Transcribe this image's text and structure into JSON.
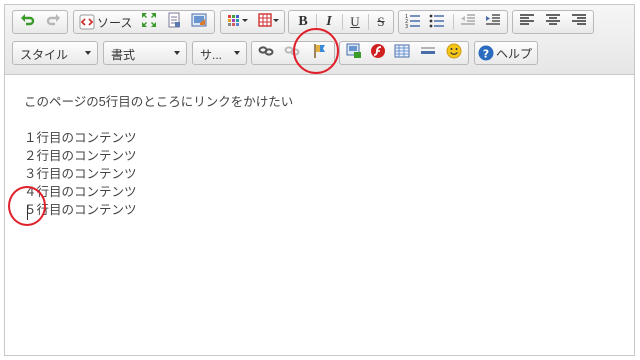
{
  "toolbar": {
    "source_label": "ソース",
    "bold_label": "B",
    "italic_label": "I",
    "underline_label": "U",
    "strike_label": "S",
    "help_label": "ヘルプ",
    "combos": {
      "style": "スタイル",
      "format": "書式",
      "size": "サ..."
    },
    "icons": [
      "undo-icon",
      "redo-icon",
      "source-icon",
      "maximize-icon",
      "document-icon",
      "image-icon",
      "color-grid-icon",
      "table-icon",
      "numbered-list-icon",
      "bulleted-list-icon",
      "outdent-icon",
      "indent-icon",
      "align-left-icon",
      "align-center-icon",
      "align-right-icon",
      "link-icon",
      "unlink-icon",
      "anchor-flag-icon",
      "insert-image-icon",
      "flash-icon",
      "table-insert-icon",
      "horizontal-rule-icon",
      "smiley-icon",
      "help-icon"
    ]
  },
  "content": {
    "intro": "このページの5行目のところにリンクをかけたい",
    "lines": [
      "１行目のコンテンツ",
      "２行目のコンテンツ",
      "３行目のコンテンツ",
      "４行目のコンテンツ",
      "５行目のコンテンツ"
    ]
  },
  "colors": {
    "annotation": "#e0202a",
    "undo_green": "#3a9a2a",
    "source_red": "#d03030"
  }
}
